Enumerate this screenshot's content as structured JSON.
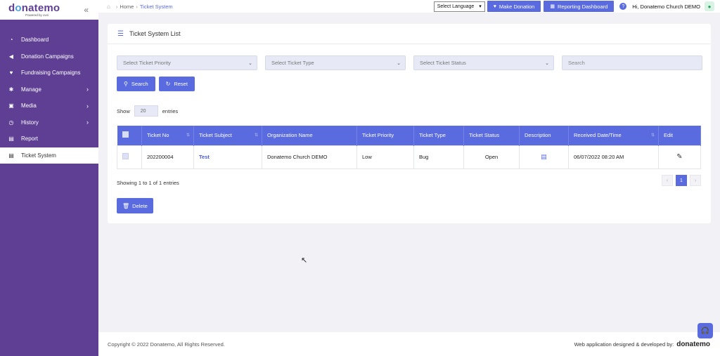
{
  "brand": {
    "logo_text_pre": "d",
    "logo_text_o": "o",
    "logo_text_post": "natemo",
    "powered_by": "Powered by ovvi",
    "accent_color": "#5a6be0",
    "sidebar_color": "#5f3f94"
  },
  "sidebar": {
    "items": [
      {
        "label": "Dashboard",
        "icon": "dashboard-icon"
      },
      {
        "label": "Donation Campaigns",
        "icon": "megaphone-icon"
      },
      {
        "label": "Fundraising Campaigns",
        "icon": "donate-icon"
      },
      {
        "label": "Manage",
        "icon": "gear-icon"
      },
      {
        "label": "Media",
        "icon": "film-icon"
      },
      {
        "label": "History",
        "icon": "clock-icon"
      },
      {
        "label": "Report",
        "icon": "file-icon"
      },
      {
        "label": "Ticket System",
        "icon": "file-icon",
        "active": true
      }
    ]
  },
  "breadcrumb": {
    "home": "Home",
    "current": "Ticket System"
  },
  "topbar": {
    "language": "Select Language",
    "make_donation": "Make Donation",
    "reporting_dashboard": "Reporting Dashboard",
    "greeting": "Hi,",
    "user_name": "Donatemo Church DEMO"
  },
  "card": {
    "title": "Ticket System List",
    "filters": {
      "priority": "Select Ticket Priority",
      "type": "Select Ticket Type",
      "status": "Select Ticket Status",
      "search_placeholder": "Search"
    },
    "search_button": "Search",
    "reset_button": "Reset",
    "show_label": "Show",
    "show_value": "20",
    "entries_label": "entries",
    "columns": [
      "Ticket No",
      "Ticket Subject",
      "Organization Name",
      "Ticket Priority",
      "Ticket Type",
      "Ticket Status",
      "Description",
      "Received Date/Time",
      "Edit"
    ],
    "rows": [
      {
        "ticket_no": "202200004",
        "subject": "Test",
        "organization": "Donatemo Church DEMO",
        "priority": "Low",
        "type": "Bug",
        "status": "Open",
        "received": "06/07/2022 08:20 AM"
      }
    ],
    "entries_info": "Showing 1 to 1 of 1 entries",
    "pagination": {
      "prev": "‹",
      "current": "1",
      "next": "›"
    },
    "delete_button": "Delete"
  },
  "footer": {
    "copyright": "Copyright © 2022 Donatemo, All Rights Reserved.",
    "developed_by": "Web application designed & developed by:",
    "dev_logo": "donatemo"
  }
}
